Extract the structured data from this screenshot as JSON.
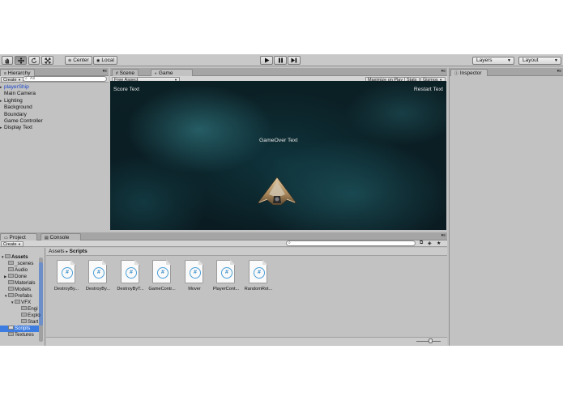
{
  "toolbar": {
    "tools": [
      "hand-tool",
      "move-tool",
      "rotate-tool",
      "scale-tool"
    ],
    "pivot_label": "Center",
    "space_label": "Local",
    "playback": [
      "play",
      "pause",
      "step"
    ],
    "layers_label": "Layers",
    "layout_label": "Layout"
  },
  "hierarchy": {
    "tab_label": "Hierarchy",
    "create_label": "Create",
    "search_placeholder": "All",
    "items": [
      {
        "label": "playerShip",
        "expandable": true,
        "color": "#1a45c8"
      },
      {
        "label": "Main Camera",
        "expandable": false
      },
      {
        "label": "Lighting",
        "expandable": true
      },
      {
        "label": "Background",
        "expandable": false
      },
      {
        "label": "Boundary",
        "expandable": false
      },
      {
        "label": "Game Controller",
        "expandable": false
      },
      {
        "label": "Display Text",
        "expandable": true
      }
    ]
  },
  "scene_tabs": {
    "scene_label": "Scene",
    "game_label": "Game",
    "aspect_label": "Free Aspect",
    "maximize_label": "Maximize on Play",
    "stats_label": "Stats",
    "gizmos_label": "Gizmos"
  },
  "game_view": {
    "score_text": "Score Text",
    "restart_text": "Restart Text",
    "gameover_text": "GameOver Text"
  },
  "inspector": {
    "tab_label": "Inspector"
  },
  "project": {
    "tab_label": "Project",
    "console_label": "Console",
    "create_label": "Create",
    "breadcrumb_root": "Assets",
    "breadcrumb_current": "Scripts",
    "tree": [
      {
        "label": "Assets",
        "depth": 0,
        "bold": true
      },
      {
        "label": "_scenes",
        "depth": 1
      },
      {
        "label": "Audio",
        "depth": 1
      },
      {
        "label": "Done",
        "depth": 1
      },
      {
        "label": "Materials",
        "depth": 1
      },
      {
        "label": "Models",
        "depth": 1
      },
      {
        "label": "Prefabs",
        "depth": 1
      },
      {
        "label": "VFX",
        "depth": 2
      },
      {
        "label": "Engi",
        "depth": 3
      },
      {
        "label": "Explo",
        "depth": 3
      },
      {
        "label": "Start",
        "depth": 3
      },
      {
        "label": "Scripts",
        "depth": 1,
        "selected": true
      },
      {
        "label": "Textures",
        "depth": 1
      }
    ],
    "assets": [
      {
        "label": "DestroyBy..."
      },
      {
        "label": "DestroyBy..."
      },
      {
        "label": "DestroyByT..."
      },
      {
        "label": "GameContr..."
      },
      {
        "label": "Mover"
      },
      {
        "label": "PlayerCont..."
      },
      {
        "label": "RandomRot..."
      }
    ]
  },
  "colors": {
    "editor_bg": "#c2c2c2",
    "selection": "#3d7ce0",
    "script_icon": "#4ba0d8",
    "game_bg": "#0b2025"
  }
}
